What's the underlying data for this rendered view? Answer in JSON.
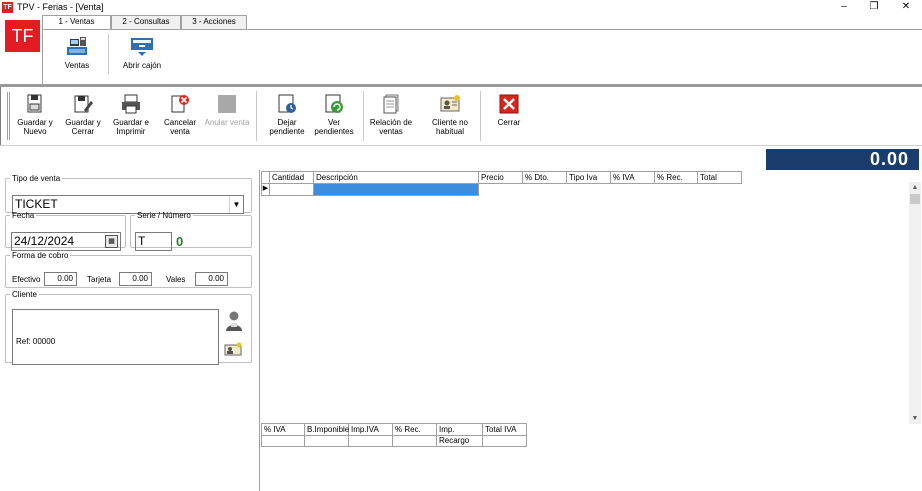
{
  "window": {
    "app_icon_text": "TF",
    "title": "TPV - Ferias - [Venta]",
    "min_glyph": "–",
    "max_glyph": "❐",
    "close_glyph": "✕"
  },
  "ribbon": {
    "logo_text": "TF",
    "tabs": [
      {
        "label": "1 - Ventas"
      },
      {
        "label": "2 - Consultas"
      },
      {
        "label": "3 - Acciones"
      }
    ],
    "buttons": [
      {
        "label": "Ventas",
        "icon": "cash-register-icon"
      },
      {
        "label": "Abrir cajón",
        "icon": "cash-drawer-icon"
      }
    ]
  },
  "toolbar": {
    "buttons": [
      {
        "label": "Guardar y Nuevo",
        "icon": "save-new-icon"
      },
      {
        "label": "Guardar y Cerrar",
        "icon": "save-close-icon"
      },
      {
        "label": "Guardar e Imprimir",
        "icon": "save-print-icon"
      },
      {
        "label": "Cancelar venta",
        "icon": "cancel-sale-icon"
      },
      {
        "label": "Anular venta",
        "icon": "void-sale-icon",
        "disabled": true
      },
      {
        "label": "Dejar pendiente",
        "icon": "pending-icon"
      },
      {
        "label": "Ver pendientes",
        "icon": "view-pending-icon"
      },
      {
        "label": "Relación de ventas",
        "icon": "sales-list-icon"
      },
      {
        "label": "Cliente no habitual",
        "icon": "occasional-client-icon"
      },
      {
        "label": "Cerrar",
        "icon": "close-red-icon"
      }
    ]
  },
  "total": "0.00",
  "form": {
    "tipo_venta_label": "Tipo de venta",
    "tipo_venta_value": "TICKET",
    "fecha_label": "Fecha",
    "fecha_value": "24/12/2024",
    "serie_label": "Serie / Número",
    "serie_value": "T",
    "numero_value": "0",
    "forma_cobro_label": "Forma de cobro",
    "efectivo_label": "Efectivo",
    "efectivo_value": "0.00",
    "tarjeta_label": "Tarjeta",
    "tarjeta_value": "0.00",
    "vales_label": "Vales",
    "vales_value": "0.00",
    "cliente_label": "Cliente",
    "cliente_ref": "Ref: 00000"
  },
  "grid": {
    "columns": [
      "Cantidad",
      "Descripción",
      "Precio",
      "% Dto.",
      "Tipo Iva",
      "% IVA",
      "% Rec.",
      "Total"
    ],
    "row_indicator": "▶"
  },
  "iva_grid": {
    "columns": [
      "% IVA",
      "B.Imponible",
      "Imp.IVA",
      "% Rec.",
      "Imp. Recargo",
      "Total IVA"
    ]
  },
  "scroll": {
    "up_glyph": "▲",
    "down_glyph": "▼"
  },
  "colors": {
    "brand_red": "#e31b23",
    "total_bg": "#1b3d6d",
    "selected_cell": "#3c8ddc",
    "number_green": "#2a7d2a"
  }
}
